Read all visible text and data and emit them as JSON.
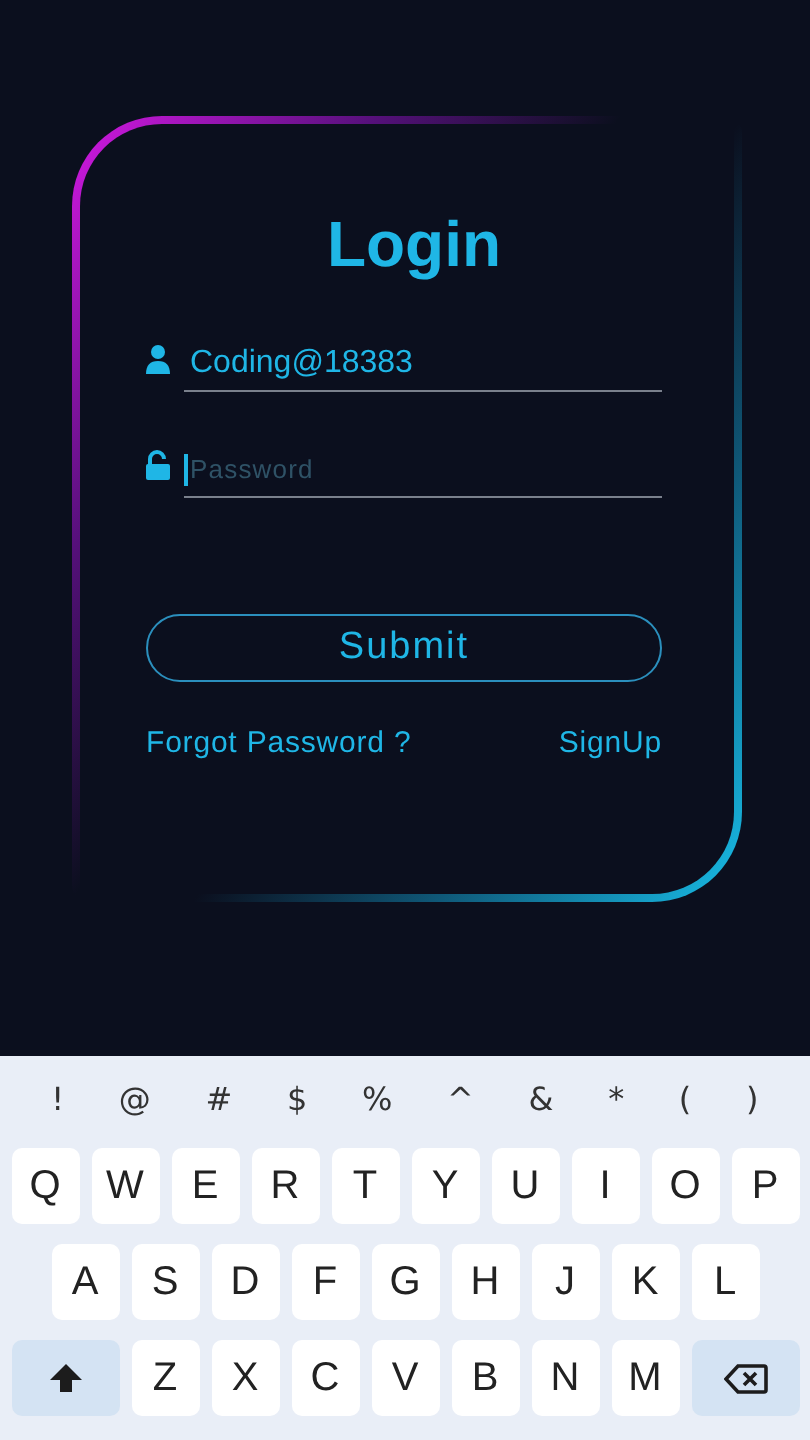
{
  "login": {
    "title": "Login",
    "fields": [
      {
        "kind": "text",
        "value": "Coding@18383",
        "focused": false
      },
      {
        "kind": "password",
        "placeholder": "Password",
        "focused": true
      }
    ],
    "submit": "Submit",
    "links": [
      "Forgot Password ?",
      "SignUp"
    ]
  },
  "keyboard": {
    "symbols": [
      "!",
      "@",
      "#",
      "$",
      "%",
      "^",
      "&",
      "*",
      "(",
      ")"
    ],
    "rows": [
      [
        {
          "kind": "letter",
          "label": "Q"
        },
        {
          "kind": "letter",
          "label": "W"
        },
        {
          "kind": "letter",
          "label": "E"
        },
        {
          "kind": "letter",
          "label": "R"
        },
        {
          "kind": "letter",
          "label": "T"
        },
        {
          "kind": "letter",
          "label": "Y"
        },
        {
          "kind": "letter",
          "label": "U"
        },
        {
          "kind": "letter",
          "label": "I"
        },
        {
          "kind": "letter",
          "label": "O"
        },
        {
          "kind": "letter",
          "label": "P"
        }
      ],
      [
        {
          "kind": "letter",
          "label": "A"
        },
        {
          "kind": "letter",
          "label": "S"
        },
        {
          "kind": "letter",
          "label": "D"
        },
        {
          "kind": "letter",
          "label": "F"
        },
        {
          "kind": "letter",
          "label": "G"
        },
        {
          "kind": "letter",
          "label": "H"
        },
        {
          "kind": "letter",
          "label": "J"
        },
        {
          "kind": "letter",
          "label": "K"
        },
        {
          "kind": "letter",
          "label": "L"
        }
      ],
      [
        {
          "kind": "shift"
        },
        {
          "kind": "letter",
          "label": "Z"
        },
        {
          "kind": "letter",
          "label": "X"
        },
        {
          "kind": "letter",
          "label": "C"
        },
        {
          "kind": "letter",
          "label": "V"
        },
        {
          "kind": "letter",
          "label": "B"
        },
        {
          "kind": "letter",
          "label": "N"
        },
        {
          "kind": "letter",
          "label": "M"
        },
        {
          "kind": "backspace"
        }
      ]
    ]
  }
}
